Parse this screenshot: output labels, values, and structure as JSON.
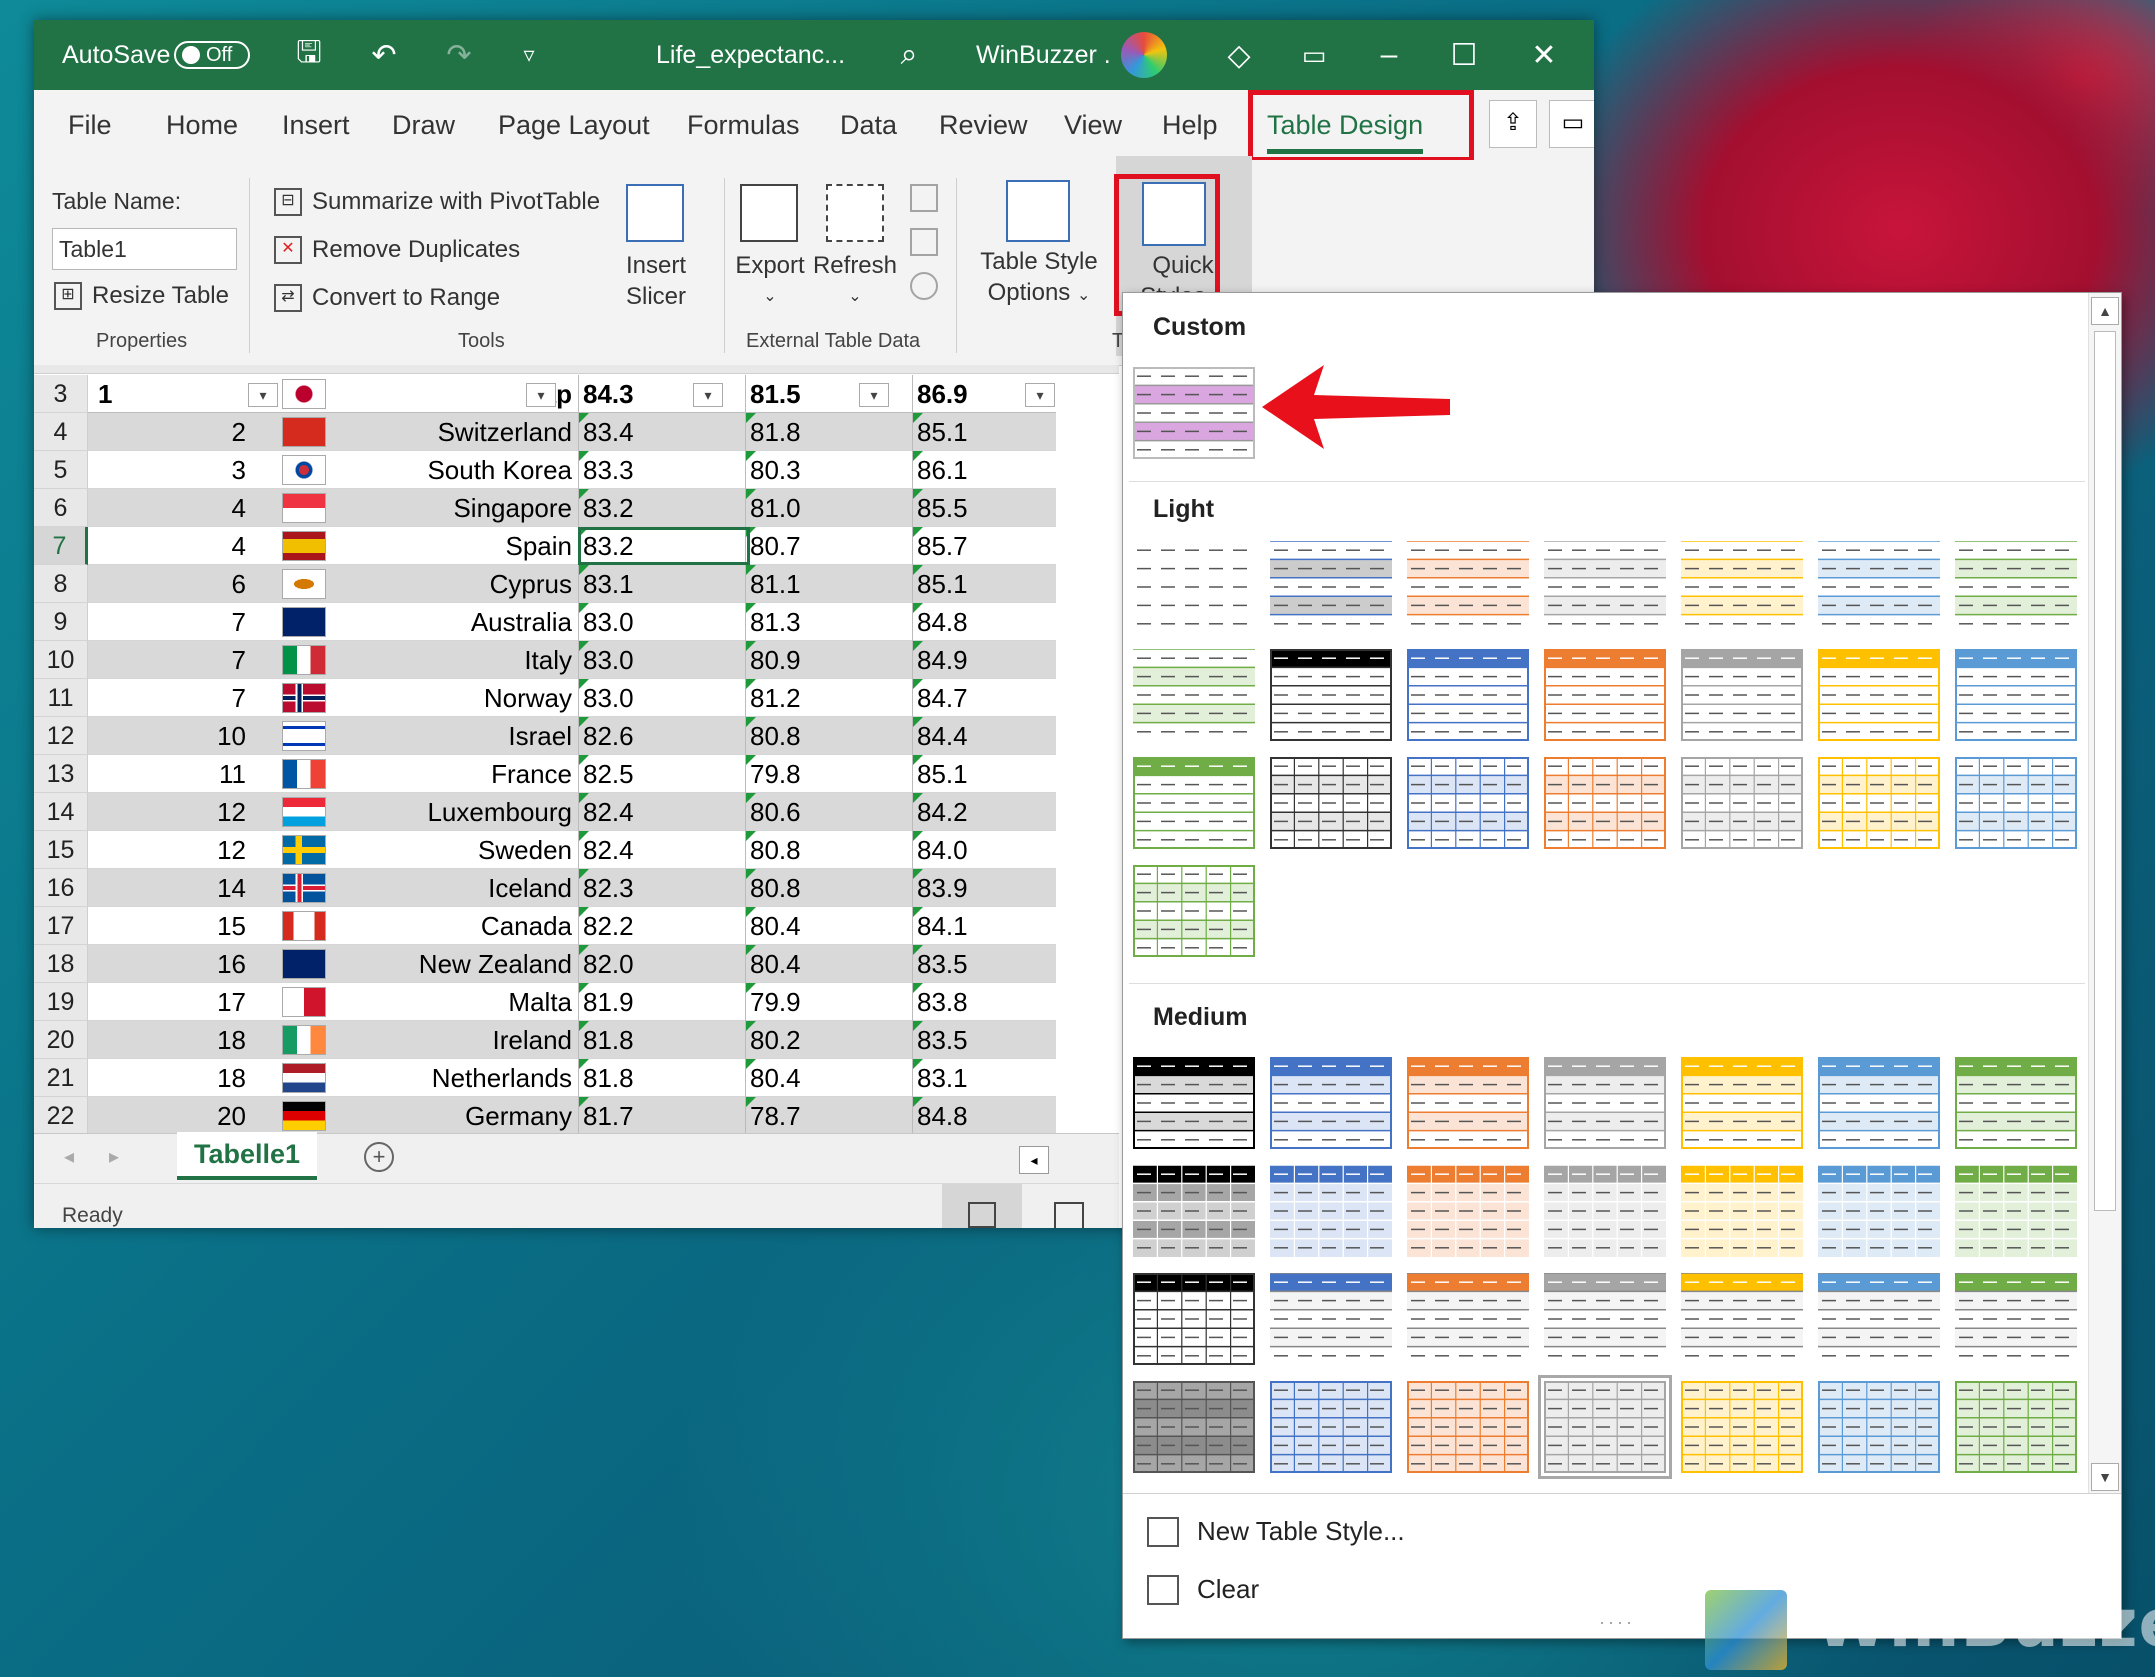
{
  "titlebar": {
    "autosave_label": "AutoSave",
    "autosave_state": "Off",
    "filename": "Life_expectanc...",
    "account": "WinBuzzer .",
    "accent": "#217346"
  },
  "tabs": [
    "File",
    "Home",
    "Insert",
    "Draw",
    "Page Layout",
    "Formulas",
    "Data",
    "Review",
    "View",
    "Help",
    "Table Design"
  ],
  "ribbon": {
    "properties": {
      "table_name_label": "Table Name:",
      "table_name_value": "Table1",
      "resize_label": "Resize Table",
      "group_label": "Properties"
    },
    "tools": {
      "pivot_label": "Summarize with PivotTable",
      "remove_dup_label": "Remove Duplicates",
      "convert_label": "Convert to Range",
      "slicer_line1": "Insert",
      "slicer_line2": "Slicer",
      "group_label": "Tools"
    },
    "external": {
      "export_label": "Export",
      "refresh_label": "Refresh",
      "group_label": "External Table Data"
    },
    "style_options_line1": "Table Style",
    "style_options_line2": "Options",
    "quick_styles_line1": "Quick",
    "quick_styles_line2": "Styles",
    "partial_group_label": "T"
  },
  "grid": {
    "header_row": {
      "row": "3",
      "rank": "1",
      "country": "Jap",
      "v1": "84.3",
      "v2": "81.5",
      "v3": "86.9"
    },
    "rows": [
      {
        "row": "4",
        "rank": "2",
        "country": "Switzerland",
        "v1": "83.4",
        "v2": "81.8",
        "v3": "85.1"
      },
      {
        "row": "5",
        "rank": "3",
        "country": "South Korea",
        "v1": "83.3",
        "v2": "80.3",
        "v3": "86.1"
      },
      {
        "row": "6",
        "rank": "4",
        "country": "Singapore",
        "v1": "83.2",
        "v2": "81.0",
        "v3": "85.5"
      },
      {
        "row": "7",
        "rank": "4",
        "country": "Spain",
        "v1": "83.2",
        "v2": "80.7",
        "v3": "85.7"
      },
      {
        "row": "8",
        "rank": "6",
        "country": "Cyprus",
        "v1": "83.1",
        "v2": "81.1",
        "v3": "85.1"
      },
      {
        "row": "9",
        "rank": "7",
        "country": "Australia",
        "v1": "83.0",
        "v2": "81.3",
        "v3": "84.8"
      },
      {
        "row": "10",
        "rank": "7",
        "country": "Italy",
        "v1": "83.0",
        "v2": "80.9",
        "v3": "84.9"
      },
      {
        "row": "11",
        "rank": "7",
        "country": "Norway",
        "v1": "83.0",
        "v2": "81.2",
        "v3": "84.7"
      },
      {
        "row": "12",
        "rank": "10",
        "country": "Israel",
        "v1": "82.6",
        "v2": "80.8",
        "v3": "84.4"
      },
      {
        "row": "13",
        "rank": "11",
        "country": "France",
        "v1": "82.5",
        "v2": "79.8",
        "v3": "85.1"
      },
      {
        "row": "14",
        "rank": "12",
        "country": "Luxembourg",
        "v1": "82.4",
        "v2": "80.6",
        "v3": "84.2"
      },
      {
        "row": "15",
        "rank": "12",
        "country": "Sweden",
        "v1": "82.4",
        "v2": "80.8",
        "v3": "84.0"
      },
      {
        "row": "16",
        "rank": "14",
        "country": "Iceland",
        "v1": "82.3",
        "v2": "80.8",
        "v3": "83.9"
      },
      {
        "row": "17",
        "rank": "15",
        "country": "Canada",
        "v1": "82.2",
        "v2": "80.4",
        "v3": "84.1"
      },
      {
        "row": "18",
        "rank": "16",
        "country": "New Zealand",
        "v1": "82.0",
        "v2": "80.4",
        "v3": "83.5"
      },
      {
        "row": "19",
        "rank": "17",
        "country": "Malta",
        "v1": "81.9",
        "v2": "79.9",
        "v3": "83.8"
      },
      {
        "row": "20",
        "rank": "18",
        "country": "Ireland",
        "v1": "81.8",
        "v2": "80.2",
        "v3": "83.5"
      },
      {
        "row": "21",
        "rank": "18",
        "country": "Netherlands",
        "v1": "81.8",
        "v2": "80.4",
        "v3": "83.1"
      },
      {
        "row": "22",
        "rank": "20",
        "country": "Germany",
        "v1": "81.7",
        "v2": "78.7",
        "v3": "84.8"
      }
    ],
    "selected_row": "7"
  },
  "sheet_tab": "Tabelle1",
  "status": "Ready",
  "gallery": {
    "custom_label": "Custom",
    "light_label": "Light",
    "medium_label": "Medium",
    "new_style_label": "New Table Style...",
    "clear_label": "Clear",
    "palette": [
      "#000000",
      "#4472c4",
      "#ed7d31",
      "#a5a5a5",
      "#ffc000",
      "#5b9bd5",
      "#70ad47"
    ],
    "custom_color": "#d9a6e0"
  },
  "watermark": "WinBuzzer"
}
